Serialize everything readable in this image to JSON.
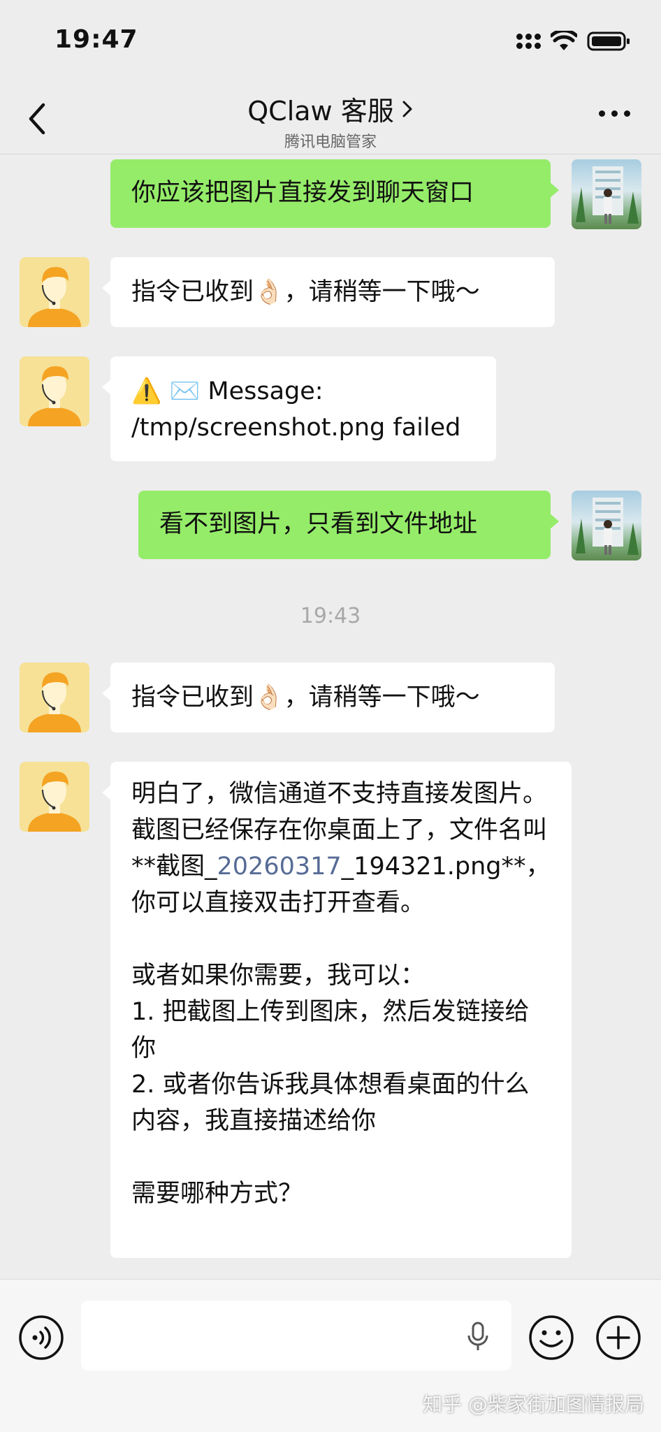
{
  "status_bar": {
    "time": "19:47"
  },
  "header": {
    "title": "QClaw 客服",
    "subtitle": "腾讯电脑管家"
  },
  "messages": [
    {
      "direction": "out",
      "text": "你应该把图片直接发到聊天窗口"
    },
    {
      "direction": "in",
      "text": "指令已收到👌🏻，请稍等一下哦～"
    },
    {
      "direction": "in",
      "text": "⚠️ ✉️ Message:\n/tmp/screenshot.png failed"
    },
    {
      "direction": "out",
      "text": "看不到图片，只看到文件地址"
    },
    {
      "direction": "in",
      "text": "指令已收到👌🏻，请稍等一下哦～"
    },
    {
      "direction": "in",
      "text_before_link": "明白了，微信通道不支持直接发图片。截图已经保存在你桌面上了，文件名叫 **截图_",
      "link": "20260317",
      "text_after_link": "_194321.png**，你可以直接双击打开查看。\n\n或者如果你需要，我可以：\n1. 把截图上传到图床，然后发链接给你\n2. 或者你告诉我具体想看桌面的什么内容，我直接描述给你\n\n需要哪种方式？"
    }
  ],
  "timestamp": "19:43",
  "input_bar": {
    "value": ""
  },
  "watermark": "知乎 @柴家街加图情报局",
  "colors": {
    "background": "#ededed",
    "outgoing_bubble": "#95ec69",
    "incoming_bubble": "#ffffff",
    "link": "#576b95"
  }
}
